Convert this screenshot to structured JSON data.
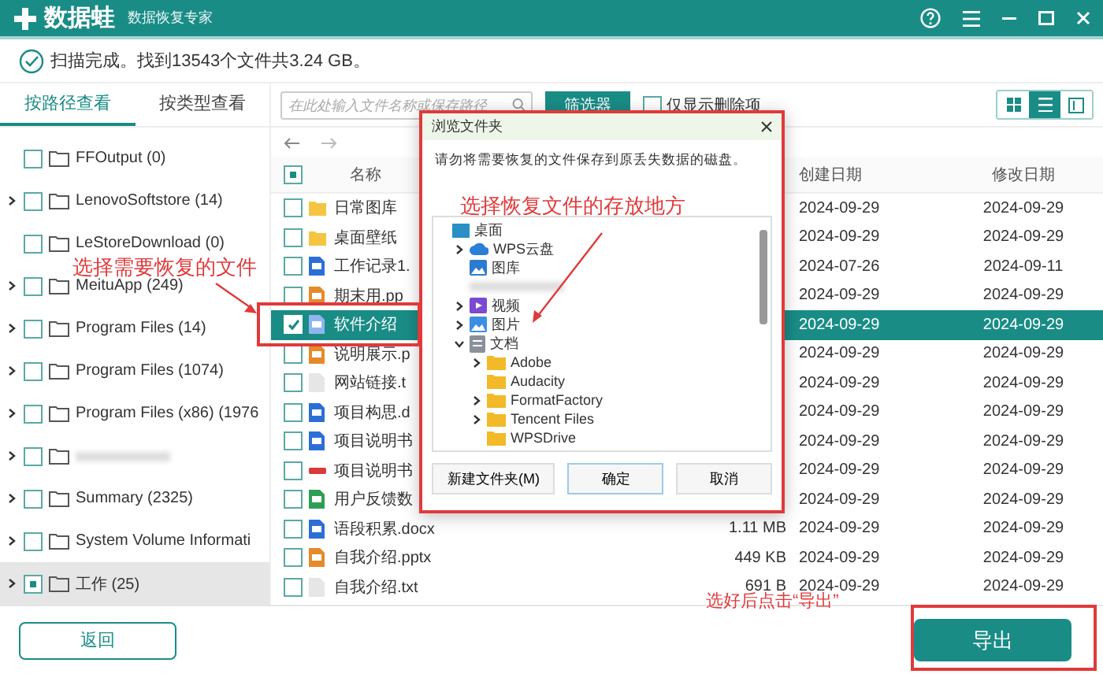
{
  "app": {
    "logo": "数据蛙",
    "subtitle": "数据恢复专家"
  },
  "scan_status": "扫描完成。找到13543个文件共3.24 GB。",
  "view_tabs": [
    {
      "label": "按路径查看",
      "selected": true
    },
    {
      "label": "按类型查看",
      "selected": false
    }
  ],
  "search": {
    "placeholder": "在此处输入文件名称或保存路径"
  },
  "filter_button": "筛选器",
  "deleted_only": {
    "label": "仅显示删除项",
    "checked": false
  },
  "view_modes": [
    {
      "kind": "grid",
      "selected": false
    },
    {
      "kind": "list",
      "selected": true
    },
    {
      "kind": "detail",
      "selected": false
    }
  ],
  "folder_tree": [
    {
      "kind": "folder",
      "label": "FFOutput (0)",
      "expandable": false,
      "checked": false,
      "selected": false
    },
    {
      "kind": "folder",
      "label": "LenovoSoftstore (14)",
      "expandable": true,
      "checked": false,
      "selected": false
    },
    {
      "kind": "folder",
      "label": "LeStoreDownload (0)",
      "expandable": false,
      "checked": false,
      "selected": false
    },
    {
      "kind": "folder",
      "label": "MeituApp (249)",
      "expandable": true,
      "checked": false,
      "selected": false
    },
    {
      "kind": "folder",
      "label": "Program Files (14)",
      "expandable": true,
      "checked": false,
      "selected": false
    },
    {
      "kind": "folder",
      "label": "Program Files (1074)",
      "expandable": true,
      "checked": false,
      "selected": false
    },
    {
      "kind": "folder",
      "label": "Program Files (x86) (1976",
      "expandable": true,
      "checked": false,
      "selected": false
    },
    {
      "kind": "redacted",
      "expandable": true,
      "checked": false,
      "selected": false
    },
    {
      "kind": "folder",
      "label": "Summary (2325)",
      "expandable": true,
      "checked": false,
      "selected": false
    },
    {
      "kind": "folder",
      "label": "System Volume Informati",
      "expandable": true,
      "checked": false,
      "selected": false
    },
    {
      "kind": "folder",
      "label": "工作 (25)",
      "expandable": true,
      "checked": true,
      "selected": true
    }
  ],
  "file_table": {
    "partial": true,
    "columns": [
      "名称",
      "创建日期",
      "修改日期"
    ],
    "rows": [
      {
        "kind": "folder",
        "name": "日常图库",
        "created": "2024-09-29",
        "modified": "2024-09-29",
        "checked": false,
        "selected": false
      },
      {
        "kind": "folder",
        "name": "桌面壁纸",
        "created": "2024-09-29",
        "modified": "2024-09-29",
        "checked": false,
        "selected": false
      },
      {
        "kind": "word",
        "name": "工作记录1.",
        "created": "2024-07-26",
        "modified": "2024-09-11",
        "checked": false,
        "selected": false
      },
      {
        "kind": "ppt",
        "name": "期末用.pp",
        "created": "2024-09-29",
        "modified": "2024-09-29",
        "checked": false,
        "selected": false
      },
      {
        "kind": "document",
        "name": "软件介绍",
        "created": "2024-09-29",
        "modified": "2024-09-29",
        "checked": true,
        "selected": true
      },
      {
        "kind": "ppt",
        "name": "说明展示.p",
        "created": "2024-09-29",
        "modified": "2024-09-29",
        "checked": false,
        "selected": false
      },
      {
        "kind": "text",
        "name": "网站链接.t",
        "created": "2024-09-29",
        "modified": "2024-09-29",
        "checked": false,
        "selected": false
      },
      {
        "kind": "word",
        "name": "项目构思.d",
        "created": "2024-09-29",
        "modified": "2024-09-29",
        "checked": false,
        "selected": false
      },
      {
        "kind": "word",
        "name": "项目说明书",
        "created": "2024-09-29",
        "modified": "2024-09-29",
        "checked": false,
        "selected": false
      },
      {
        "kind": "pdf",
        "name": "项目说明书",
        "created": "2024-09-29",
        "modified": "2024-09-29",
        "checked": false,
        "selected": false
      },
      {
        "kind": "excel",
        "name": "用户反馈数",
        "created": "2024-09-29",
        "modified": "2024-09-29",
        "checked": false,
        "selected": false
      },
      {
        "kind": "word",
        "name": "语段积累.docx",
        "size": "1.11 MB",
        "created": "2024-09-29",
        "modified": "2024-09-29",
        "checked": false,
        "selected": false
      },
      {
        "kind": "ppt",
        "name": "自我介绍.pptx",
        "size": "449 KB",
        "created": "2024-09-29",
        "modified": "2024-09-29",
        "checked": false,
        "selected": false
      },
      {
        "kind": "text",
        "name": "自我介绍.txt",
        "size": "691 B",
        "created": "2024-09-29",
        "modified": "2024-09-29",
        "checked": false,
        "selected": false
      }
    ]
  },
  "back_button": "返回",
  "export_button": "导出",
  "dialog": {
    "title": "浏览文件夹",
    "message": "请勿将需要恢复的文件保存到原丢失数据的磁盘。",
    "tree": [
      {
        "kind": "desktop",
        "label": "桌面",
        "expandable": false,
        "children": [
          {
            "kind": "cloud",
            "label": "WPS云盘",
            "expandable": true,
            "expanded": false
          },
          {
            "kind": "gallery",
            "label": "图库",
            "expandable": false
          },
          {
            "kind": "redacted",
            "expandable": false
          },
          {
            "kind": "video",
            "label": "视频",
            "expandable": true,
            "expanded": false
          },
          {
            "kind": "pictures",
            "label": "图片",
            "expandable": true,
            "expanded": false
          },
          {
            "kind": "documents",
            "label": "文档",
            "expandable": true,
            "expanded": true,
            "children": [
              {
                "kind": "folder",
                "label": "Adobe",
                "expandable": true,
                "expanded": false
              },
              {
                "kind": "folder",
                "label": "Audacity",
                "expandable": false
              },
              {
                "kind": "folder",
                "label": "FormatFactory",
                "expandable": true,
                "expanded": false
              },
              {
                "kind": "folder",
                "label": "Tencent Files",
                "expandable": true,
                "expanded": false
              },
              {
                "kind": "folder",
                "label": "WPSDrive",
                "expandable": false
              }
            ]
          }
        ]
      }
    ],
    "buttons": [
      "新建文件夹(M)",
      "确定",
      "取消"
    ]
  },
  "annotations": [
    "选择需要恢复的文件",
    "选择恢复文件的存放地方",
    "选好后点击“导出”"
  ]
}
